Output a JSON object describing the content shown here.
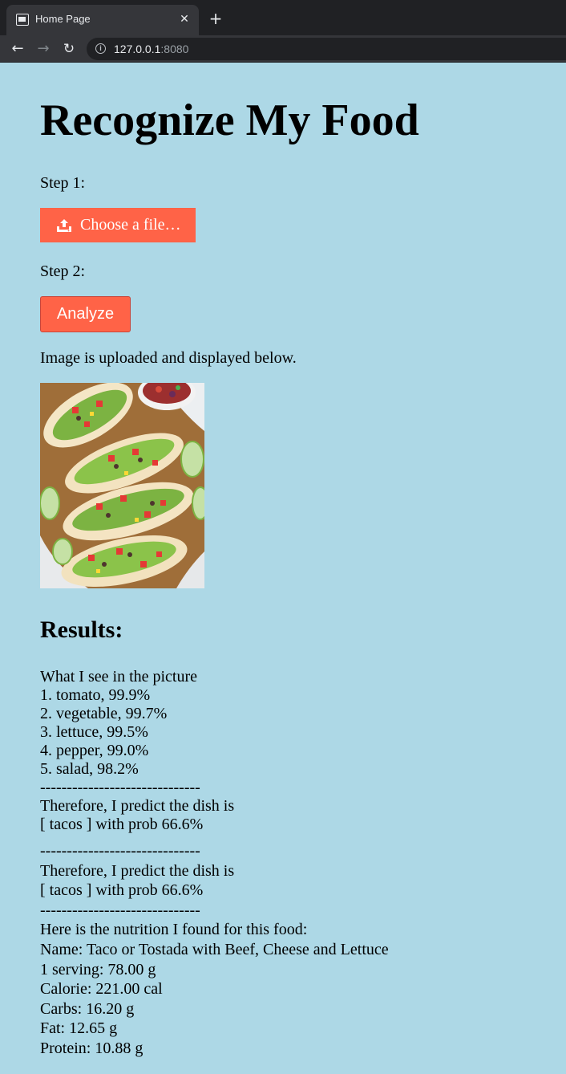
{
  "browser": {
    "tab_title": "Home Page",
    "tab_close": "✕",
    "new_tab": "+",
    "url_host": "127.0.0.1",
    "url_port": ":8080",
    "info_symbol": "i",
    "back_glyph": "←",
    "forward_glyph": "→",
    "reload_glyph": "↻"
  },
  "page": {
    "title": "Recognize My Food",
    "step1_label": "Step 1:",
    "choose_file_label": "Choose a file…",
    "step2_label": "Step 2:",
    "analyze_label": "Analyze",
    "upload_message": "Image is uploaded and displayed below.",
    "results_heading": "Results:"
  },
  "results": {
    "intro": "What I see in the picture",
    "predictions": [
      "1. tomato, 99.9%",
      "2. vegetable, 99.7%",
      "3. lettuce, 99.5%",
      "4. pepper, 99.0%",
      "5. salad, 98.2%"
    ],
    "separator": "------------------------------",
    "conclusion_line1": "Therefore, I predict the dish is",
    "conclusion_line2": "[ tacos ] with prob 66.6%",
    "separator2": "------------------------------",
    "conclusion_repeat_line1": "Therefore, I predict the dish is",
    "conclusion_repeat_line2": "[ tacos ] with prob 66.6%",
    "separator3": "------------------------------",
    "nutrition_intro": "Here is the nutrition I found for this food:",
    "nutrition_name": "Name: Taco or Tostada with Beef, Cheese and Lettuce",
    "nutrition_serving": "1 serving: 78.00 g",
    "nutrition_calorie": "Calorie: 221.00 cal",
    "nutrition_carbs": "Carbs: 16.20 g",
    "nutrition_fat": "Fat: 12.65 g",
    "nutrition_protein": "Protein: 10.88 g"
  },
  "colors": {
    "page_background": "#add8e6",
    "button_background": "#ff6347",
    "button_text": "#ffffff"
  },
  "icons": {
    "upload": "upload-icon",
    "info": "info-icon"
  }
}
